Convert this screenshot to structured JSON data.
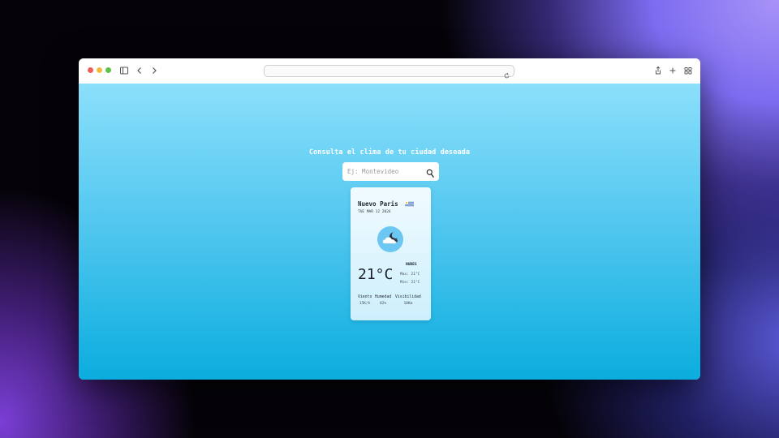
{
  "browser": {
    "address": "",
    "controls": [
      "sidebar-icon",
      "back-icon",
      "forward-icon",
      "reload-icon",
      "share-icon",
      "new-tab-icon",
      "tab-overview-icon"
    ]
  },
  "page": {
    "headline": "Consulta el clima de tu ciudad deseada",
    "search": {
      "placeholder": "Ej: Montevideo",
      "value": "",
      "icon": "search-icon"
    },
    "weather": {
      "city": "Nuevo Paris",
      "flag": "uruguay-flag-icon",
      "date": "TUE MAR 12 2024",
      "icon": "partly-cloudy-night-icon",
      "temperature": "21°C",
      "condition": "NUBES",
      "max": "Max: 21°C",
      "min": "Min: 21°C",
      "stats": [
        {
          "label": "Viento",
          "value": "15K/h"
        },
        {
          "label": "Humedad",
          "value": "82%"
        },
        {
          "label": "Visibilidad",
          "value": "10Km"
        }
      ]
    }
  },
  "colors": {
    "gradient_top": "#8be0fb",
    "gradient_bottom": "#0badde",
    "card_bg": "#e6f7fd",
    "weather_icon_bg": "#6cc7f2"
  }
}
